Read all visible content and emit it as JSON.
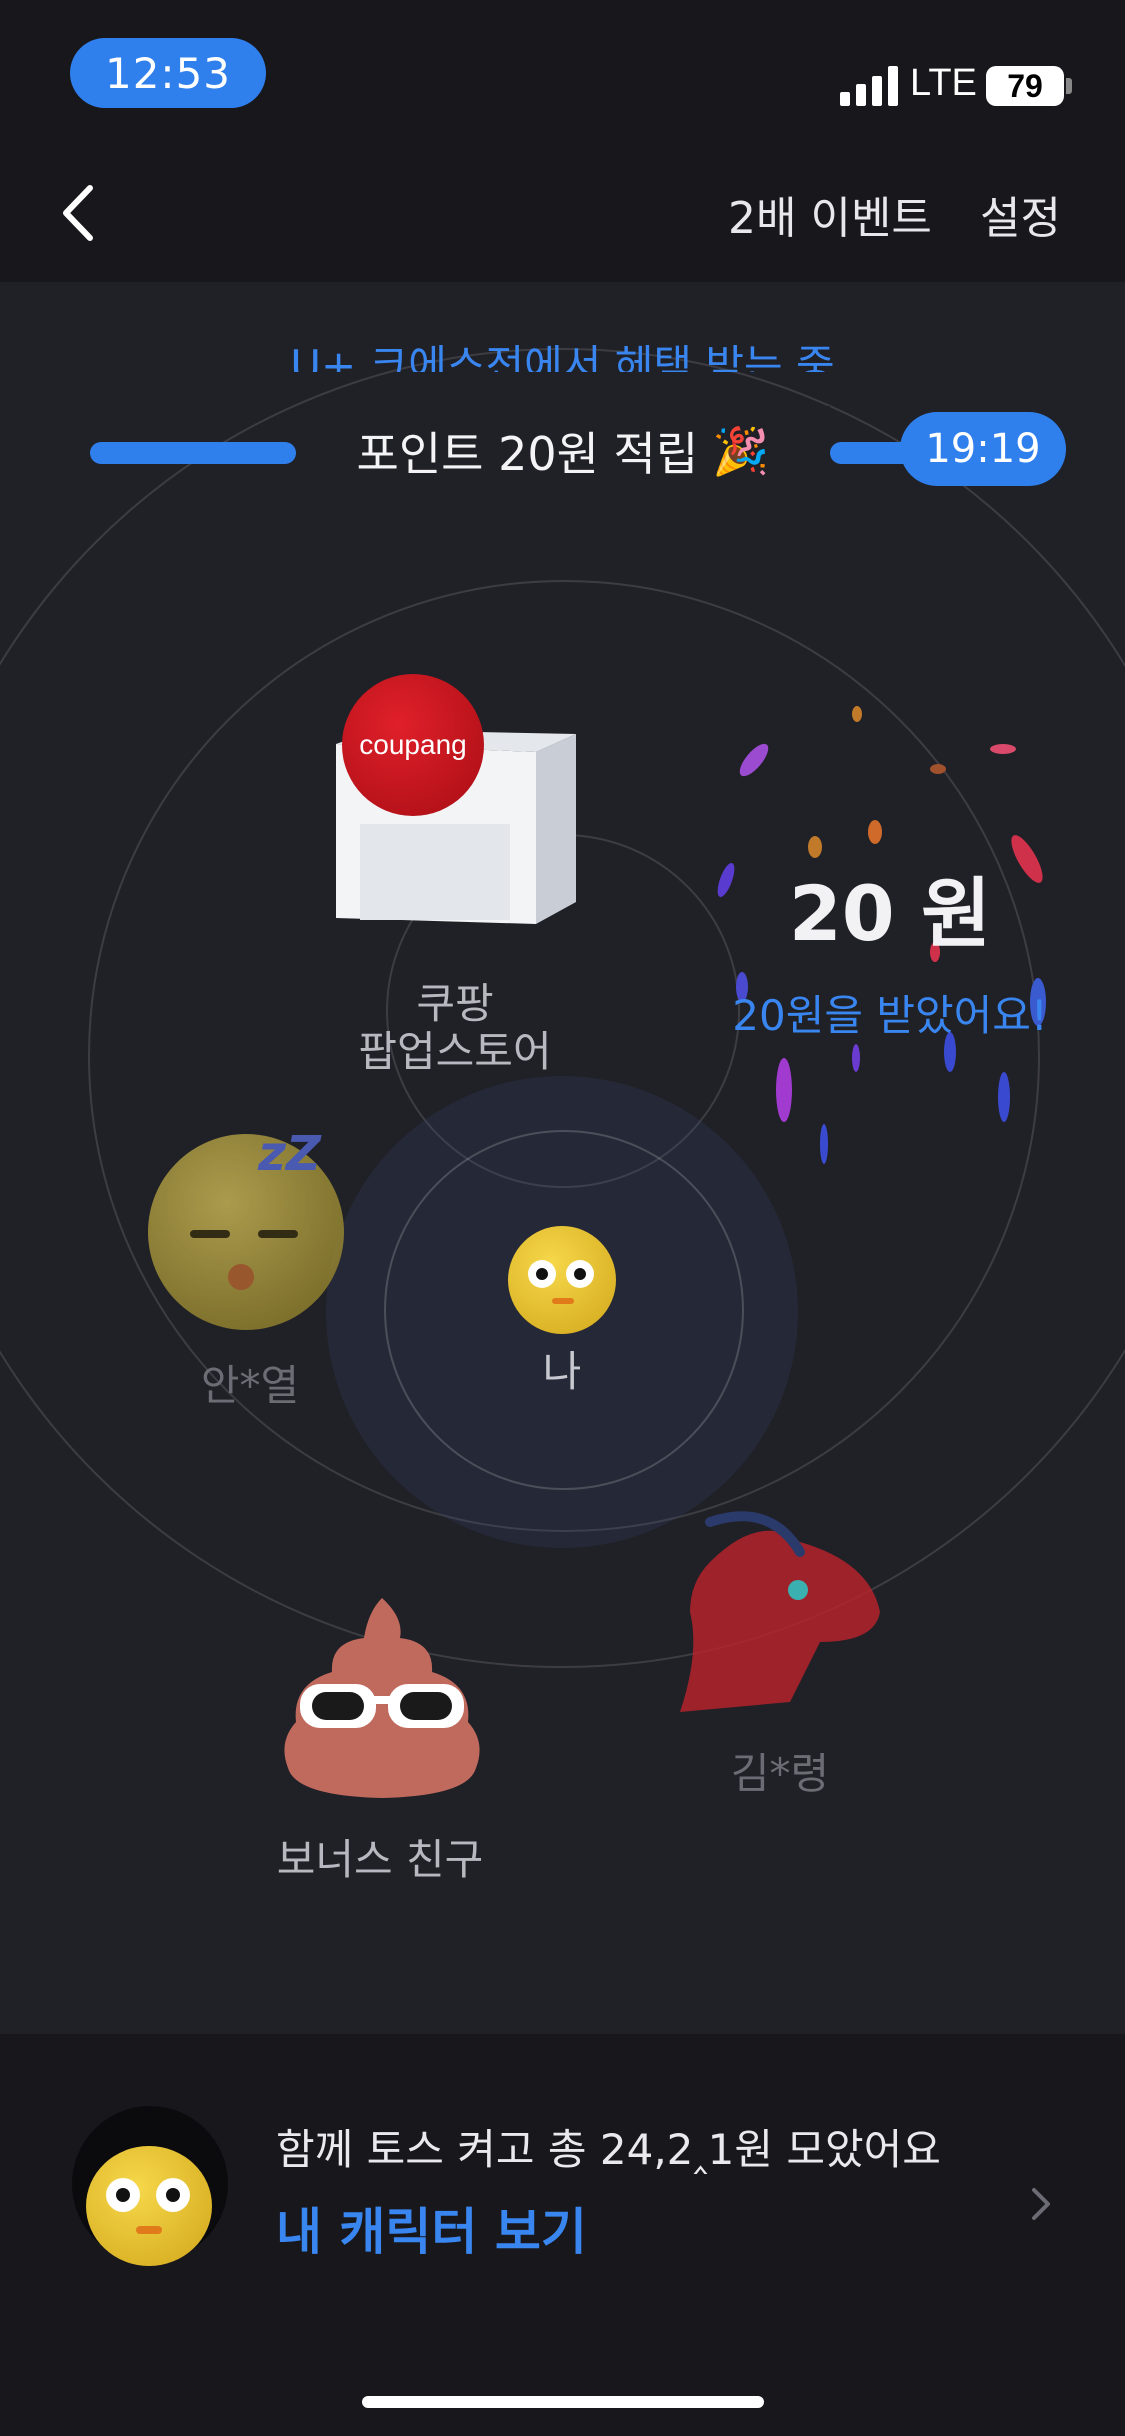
{
  "status": {
    "time": "12:53",
    "network": "LTE",
    "battery": "79"
  },
  "nav": {
    "event_label": "2배 이벤트",
    "settings_label": "설정"
  },
  "radar": {
    "ticker": "U+ 크에스전에서 헤택 받는 중",
    "banner_title": "포인트 20원 적립",
    "banner_emoji": "🎉",
    "timer": "19:19",
    "store": {
      "logo_text": "coupang",
      "label_line1": "쿠팡",
      "label_line2": "팝업스토어"
    },
    "reward": {
      "amount": "20 원",
      "message": "20원을 받았어요!"
    },
    "people": [
      {
        "name": "안*열"
      },
      {
        "name": "나"
      },
      {
        "name": "김*령"
      },
      {
        "name": "보너스 친구"
      }
    ]
  },
  "bottom": {
    "summary": "함께 토스 켜고 총  24,2‸1원  모았어요",
    "cta": "내 캐릭터 보기"
  },
  "colors": {
    "accent": "#2f80ed",
    "background": "#17171c",
    "radar_bg": "#202027"
  }
}
